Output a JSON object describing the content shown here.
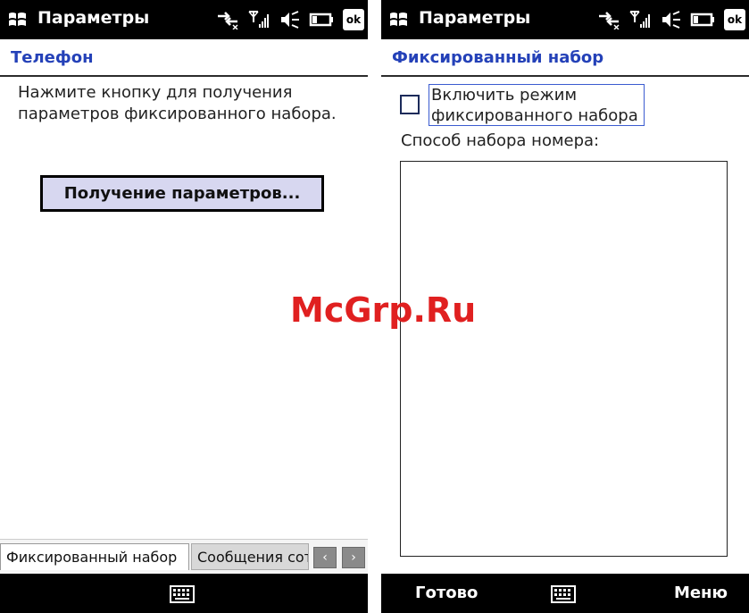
{
  "left": {
    "title": "Параметры",
    "section_header": "Телефон",
    "instruction": "Нажмите кнопку для получения параметров фиксированного набора.",
    "button_label": "Получение параметров...",
    "tabs": [
      {
        "label": "Фиксированный набор",
        "active": true
      },
      {
        "label": "Сообщения сот",
        "active": false
      }
    ],
    "scroll_left": "‹",
    "scroll_right": "›"
  },
  "right": {
    "title": "Параметры",
    "section_header": "Фиксированный набор",
    "checkbox_label": "Включить режим фиксированного набора",
    "checkbox_checked": false,
    "dial_method_label": "Способ набора номера:",
    "softkey_left": "Готово",
    "softkey_right": "Меню"
  },
  "status": {
    "ok_label": "ok",
    "icons": [
      "connectivity-icon",
      "signal-icon",
      "speaker-muted-icon",
      "battery-icon"
    ]
  },
  "watermark": "McGrp.Ru"
}
